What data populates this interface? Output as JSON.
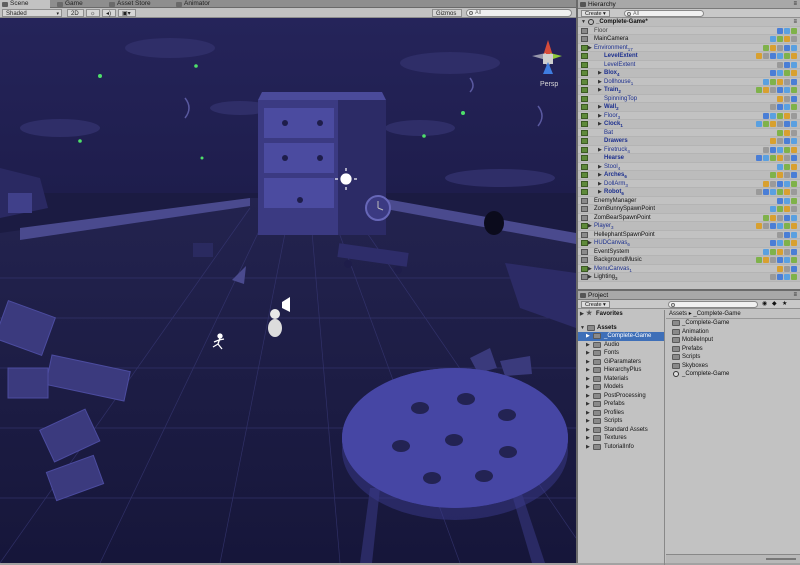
{
  "tabs": [
    {
      "label": "Scene",
      "active": true,
      "icon": "scene-icon"
    },
    {
      "label": "Game",
      "active": false,
      "icon": "game-icon"
    },
    {
      "label": "Asset Store",
      "active": false,
      "icon": "store-icon"
    },
    {
      "label": "Animator",
      "active": false,
      "icon": "animator-icon"
    }
  ],
  "scene_toolbar": {
    "shading": "Shaded",
    "mode_2d": "2D",
    "gizmos": "Gizmos",
    "search_placeholder": "All",
    "persp_label": "Persp"
  },
  "hierarchy": {
    "title": "Hierarchy",
    "create": "Create",
    "search_placeholder": "All",
    "scene_name": "_Complete-Game*",
    "rows": [
      {
        "label": "Floor",
        "indent": 0,
        "style": "dim",
        "arrow": false
      },
      {
        "label": "MainCamera",
        "indent": 0,
        "style": "normal",
        "arrow": false
      },
      {
        "label": "Environment",
        "count": "17",
        "indent": 0,
        "style": "prefab",
        "arrow": true
      },
      {
        "label": "LevelExtent",
        "indent": 1,
        "style": "bold",
        "arrow": false
      },
      {
        "label": "LevelExtent",
        "indent": 1,
        "style": "prefab",
        "arrow": false
      },
      {
        "label": "Blox",
        "count": "4",
        "indent": 1,
        "style": "bold",
        "arrow": true
      },
      {
        "label": "Dollhouse",
        "count": "1",
        "indent": 1,
        "style": "prefab",
        "arrow": true
      },
      {
        "label": "Train",
        "count": "2",
        "indent": 1,
        "style": "bold",
        "arrow": true
      },
      {
        "label": "SpinningTop",
        "indent": 1,
        "style": "prefab",
        "arrow": false
      },
      {
        "label": "Wall",
        "count": "2",
        "indent": 1,
        "style": "bold",
        "arrow": true
      },
      {
        "label": "Floor",
        "count": "3",
        "indent": 1,
        "style": "prefab",
        "arrow": true
      },
      {
        "label": "Clock",
        "count": "1",
        "indent": 1,
        "style": "bold",
        "arrow": true
      },
      {
        "label": "Bat",
        "indent": 1,
        "style": "prefab",
        "arrow": false
      },
      {
        "label": "Drawers",
        "indent": 1,
        "style": "bold",
        "arrow": false
      },
      {
        "label": "Firetruck",
        "count": "4",
        "indent": 1,
        "style": "prefab",
        "arrow": true
      },
      {
        "label": "Hearse",
        "indent": 1,
        "style": "bold",
        "arrow": false
      },
      {
        "label": "Stool",
        "count": "4",
        "indent": 1,
        "style": "prefab",
        "arrow": true
      },
      {
        "label": "Arches",
        "count": "6",
        "indent": 1,
        "style": "bold",
        "arrow": true
      },
      {
        "label": "DollArm",
        "count": "3",
        "indent": 1,
        "style": "prefab",
        "arrow": true
      },
      {
        "label": "Robot",
        "count": "6",
        "indent": 1,
        "style": "bold",
        "arrow": true
      },
      {
        "label": "EnemyManager",
        "indent": 0,
        "style": "normal",
        "arrow": false
      },
      {
        "label": "ZomBunnySpawnPoint",
        "indent": 0,
        "style": "normal",
        "arrow": false
      },
      {
        "label": "ZomBearSpawnPoint",
        "indent": 0,
        "style": "normal",
        "arrow": false
      },
      {
        "label": "Player",
        "count": "3",
        "indent": 0,
        "style": "prefab",
        "arrow": true
      },
      {
        "label": "HellephantSpawnPoint",
        "indent": 0,
        "style": "normal",
        "arrow": false
      },
      {
        "label": "HUDCanvas",
        "count": "6",
        "indent": 0,
        "style": "prefab",
        "arrow": true
      },
      {
        "label": "EventSystem",
        "indent": 0,
        "style": "normal",
        "arrow": false
      },
      {
        "label": "BackgroundMusic",
        "indent": 0,
        "style": "normal",
        "arrow": false
      },
      {
        "label": "MenuCanvas",
        "count": "1",
        "indent": 0,
        "style": "prefab",
        "arrow": true
      },
      {
        "label": "Lighting",
        "count": "3",
        "indent": 0,
        "style": "normal",
        "arrow": true
      }
    ]
  },
  "project": {
    "title": "Project",
    "create": "Create",
    "favorites": "Favorites",
    "assets": "Assets",
    "breadcrumb": [
      "Assets",
      "_Complete-Game"
    ],
    "tree": [
      {
        "label": "_Complete-Game",
        "selected": true
      },
      {
        "label": "Audio",
        "selected": false
      },
      {
        "label": "Fonts",
        "selected": false
      },
      {
        "label": "GiParamaters",
        "selected": false
      },
      {
        "label": "HierarchyPlus",
        "selected": false
      },
      {
        "label": "Materials",
        "selected": false
      },
      {
        "label": "Models",
        "selected": false
      },
      {
        "label": "PostProcessing",
        "selected": false
      },
      {
        "label": "Prefabs",
        "selected": false
      },
      {
        "label": "Profiles",
        "selected": false
      },
      {
        "label": "Scripts",
        "selected": false
      },
      {
        "label": "Standard Assets",
        "selected": false
      },
      {
        "label": "Textures",
        "selected": false
      },
      {
        "label": "TutorialInfo",
        "selected": false
      }
    ],
    "contents": [
      {
        "label": "_Complete-Game",
        "kind": "folder"
      },
      {
        "label": "Animation",
        "kind": "folder"
      },
      {
        "label": "MobileInput",
        "kind": "folder"
      },
      {
        "label": "Prefabs",
        "kind": "folder"
      },
      {
        "label": "Scripts",
        "kind": "folder"
      },
      {
        "label": "Skyboxes",
        "kind": "folder"
      },
      {
        "label": "_Complete-Game",
        "kind": "scene"
      }
    ]
  },
  "colors": {
    "scene_bg": "#1b1b42",
    "selection": "#3e6fb8",
    "prefab_text": "#1c2f8e"
  }
}
